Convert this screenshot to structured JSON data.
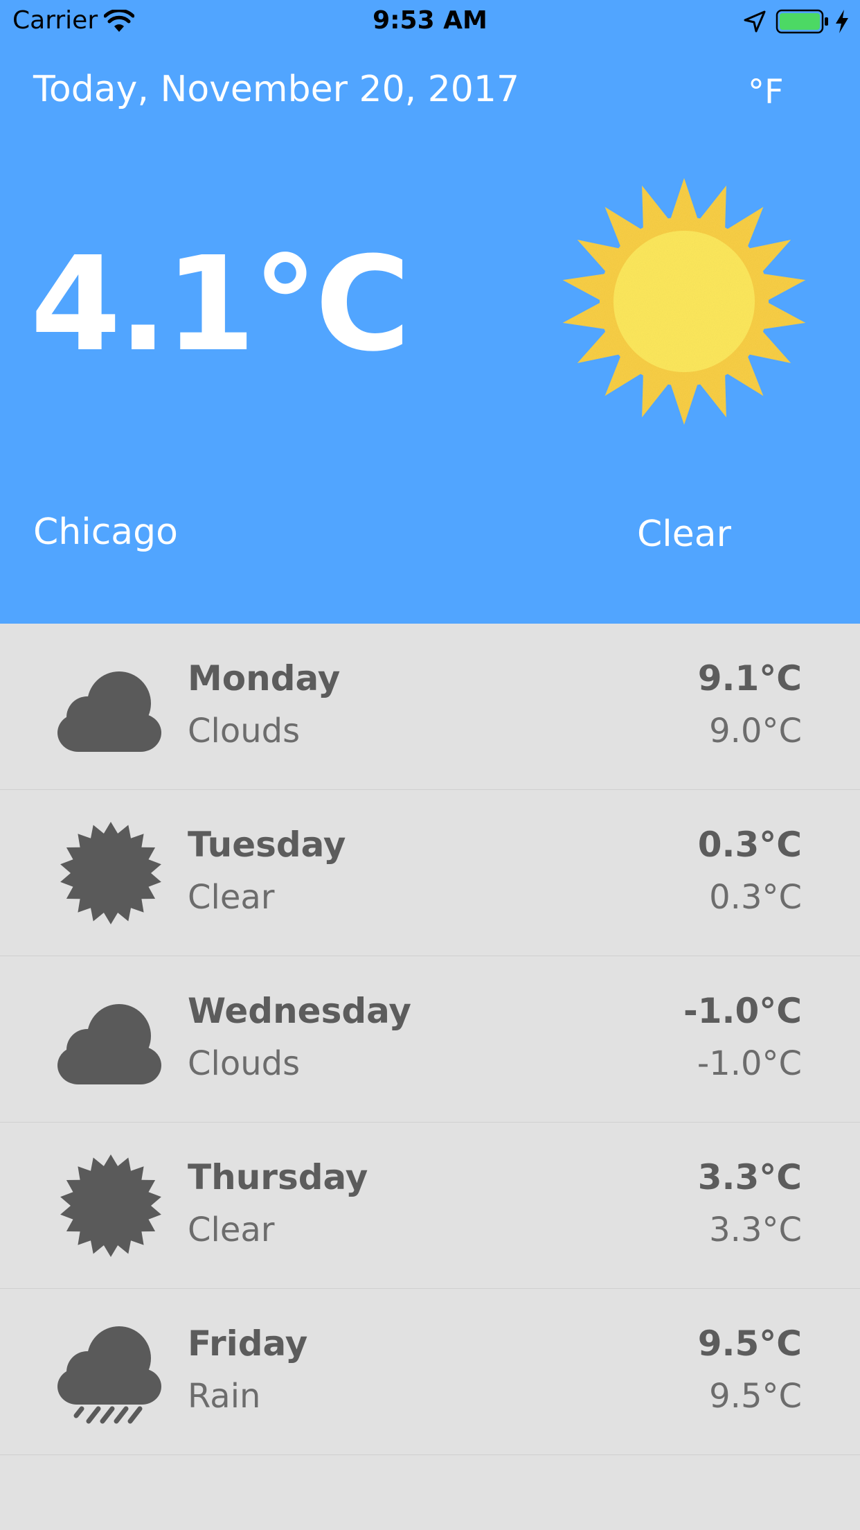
{
  "status_bar": {
    "carrier": "Carrier",
    "time": "9:53 AM"
  },
  "header": {
    "date": "Today, November 20, 2017",
    "unit_toggle": "°F"
  },
  "current": {
    "temperature": "4.1°C",
    "city": "Chicago",
    "condition": "Clear",
    "icon": "sun-icon"
  },
  "forecast": [
    {
      "day": "Monday",
      "condition": "Clouds",
      "high": "9.1°C",
      "low": "9.0°C",
      "icon": "cloud-icon"
    },
    {
      "day": "Tuesday",
      "condition": "Clear",
      "high": "0.3°C",
      "low": "0.3°C",
      "icon": "sun-icon"
    },
    {
      "day": "Wednesday",
      "condition": "Clouds",
      "high": "-1.0°C",
      "low": "-1.0°C",
      "icon": "cloud-icon"
    },
    {
      "day": "Thursday",
      "condition": "Clear",
      "high": "3.3°C",
      "low": "3.3°C",
      "icon": "sun-icon"
    },
    {
      "day": "Friday",
      "condition": "Rain",
      "high": "9.5°C",
      "low": "9.5°C",
      "icon": "rain-cloud-icon"
    }
  ],
  "colors": {
    "header_background": "#51a5ff",
    "list_background": "#e1e1e1",
    "icon_gray": "#5a5a5a",
    "sun_yellow": "#fde85c",
    "sun_orange": "#f9cf45",
    "battery_green": "#4cd964"
  }
}
